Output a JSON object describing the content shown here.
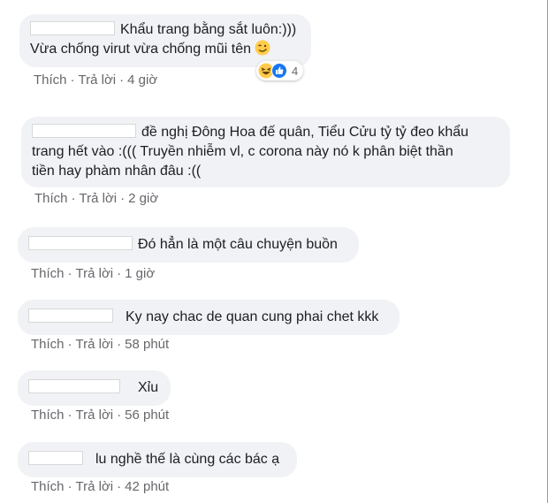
{
  "comments": [
    {
      "text_line1": "Khẩu trang bằng sắt luôn:)))",
      "text_line2": "Vừa chống virut vừa chống mũi tên",
      "inline_emoji": "smirk-face",
      "reactions": {
        "icons": [
          "laughing-face",
          "like-thumb"
        ],
        "count": "4"
      },
      "like": "Thích",
      "reply": "Trả lời",
      "time": "4 giờ"
    },
    {
      "text_line1": "đề nghị Đông Hoa đế quân, Tiểu Cửu tỷ tỷ đeo khẩu",
      "text_line2": "trang hết vào :((( Truyền nhiễm vl, c corona này nó k phân biệt thần",
      "text_line3": "tiền hay phàm nhân đâu :((",
      "like": "Thích",
      "reply": "Trả lời",
      "time": "2 giờ"
    },
    {
      "text": "Đó hẳn là một câu chuyện buồn",
      "like": "Thích",
      "reply": "Trả lời",
      "time": "1 giờ"
    },
    {
      "text": "Ky nay chac de quan cung phai chet kkk",
      "like": "Thích",
      "reply": "Trả lời",
      "time": "58 phút"
    },
    {
      "text": "Xỉu",
      "like": "Thích",
      "reply": "Trả lời",
      "time": "56 phút"
    },
    {
      "text": "lu nghề thế là cùng các bác ạ",
      "like": "Thích",
      "reply": "Trả lời",
      "time": "42 phút"
    }
  ],
  "colors": {
    "bubble": "#f0f2f5",
    "text": "#1c1e21",
    "meta": "#65676b",
    "like_blue": "#1877f2",
    "emoji_yellow": "#ffcc4d"
  }
}
